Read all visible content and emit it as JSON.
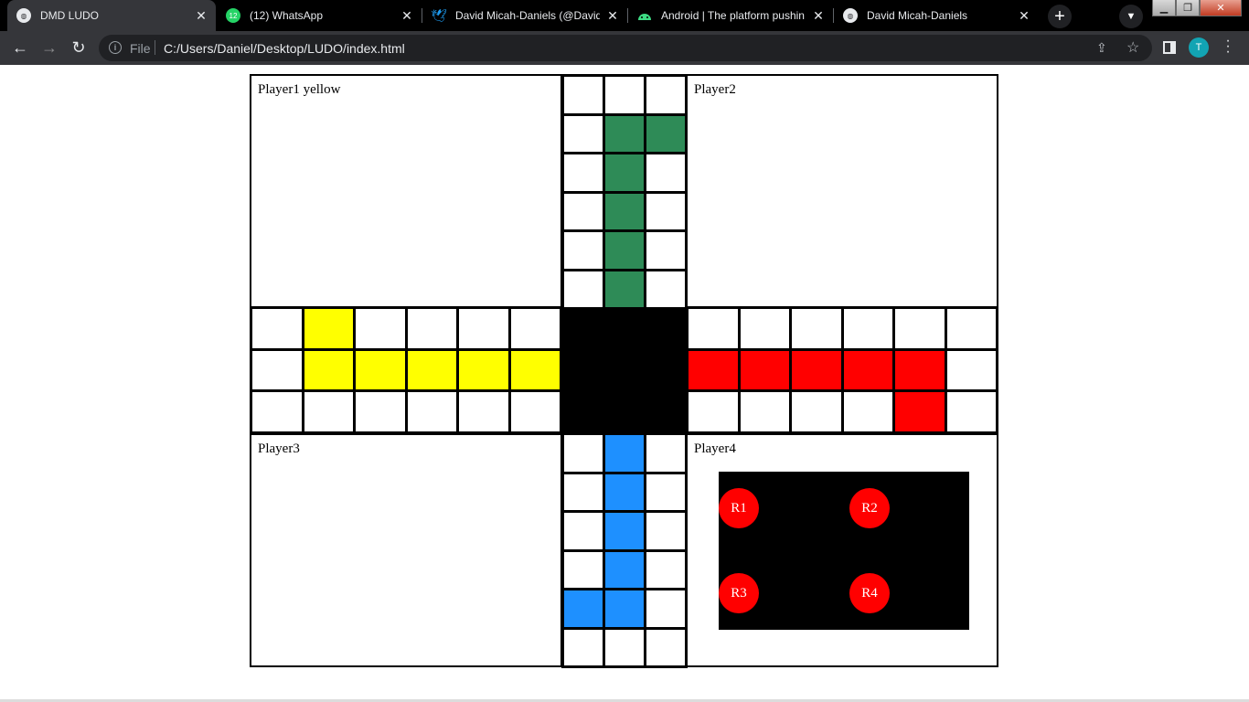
{
  "browser": {
    "tabs": [
      {
        "title": "DMD LUDO",
        "icon": "globe-icon",
        "active": true
      },
      {
        "title": "(12) WhatsApp",
        "icon": "whatsapp-icon",
        "badge": "12"
      },
      {
        "title": "David Micah-Daniels (@David",
        "icon": "twitter-icon"
      },
      {
        "title": "Android | The platform pushin",
        "icon": "android-icon"
      },
      {
        "title": "David Micah-Daniels",
        "icon": "globe-icon"
      }
    ],
    "new_tab": "+",
    "address": {
      "scheme": "File",
      "url": "C:/Users/Daniel/Desktop/LUDO/index.html"
    },
    "profile_initial": "T"
  },
  "board": {
    "homes": {
      "top_left": "Player1 yellow",
      "top_right": "Player2",
      "bottom_left": "Player3",
      "bottom_right": "Player4"
    },
    "colors": {
      "yellow": "#ffff00",
      "green": "#2e8b57",
      "red": "#ff0000",
      "blue": "#1e90ff",
      "center": "#000000"
    },
    "tokens": [
      "R1",
      "R2",
      "R3",
      "R4"
    ]
  }
}
